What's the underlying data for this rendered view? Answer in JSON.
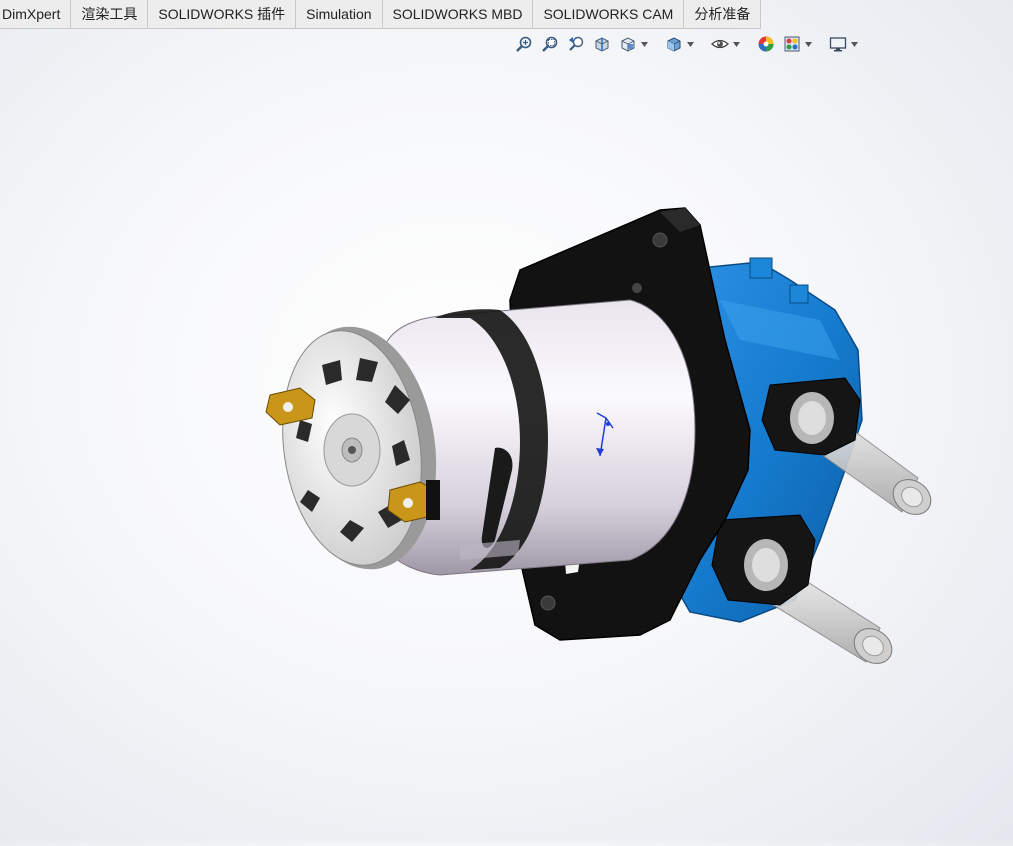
{
  "tabs": [
    {
      "label": "DimXpert"
    },
    {
      "label": "渲染工具"
    },
    {
      "label": "SOLIDWORKS 插件"
    },
    {
      "label": "Simulation"
    },
    {
      "label": "SOLIDWORKS MBD"
    },
    {
      "label": "SOLIDWORKS CAM"
    },
    {
      "label": "分析准备"
    }
  ],
  "heads_up_toolbar": [
    "zoom-to-fit-icon",
    "zoom-to-area-icon",
    "previous-view-icon",
    "section-view-icon",
    "view-orientation-icon",
    "display-style-icon",
    "hide-show-items-icon",
    "edit-appearance-icon",
    "apply-scene-icon",
    "view-settings-icon"
  ],
  "colors": {
    "tab_bg": "#ededed",
    "pump_housing": "#1a7fd4",
    "motor_can": "#e8e4ec",
    "bracket": "#111111",
    "terminal": "#b8860b",
    "tube": "#d8d8d8",
    "triad": "#1f3fd8"
  }
}
